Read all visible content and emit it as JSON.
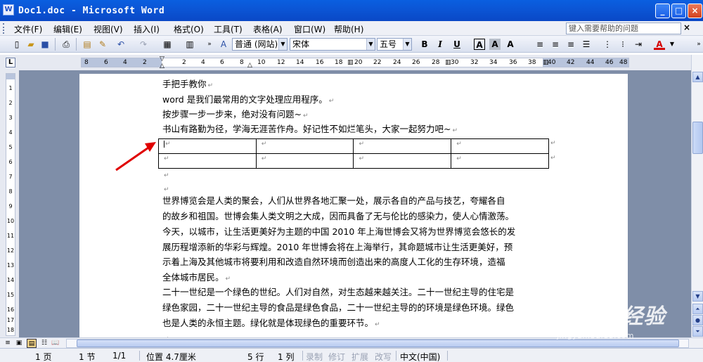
{
  "window": {
    "title": "Doc1.doc - Microsoft Word",
    "app_icon": "W"
  },
  "menu": {
    "items": [
      "文件(F)",
      "编辑(E)",
      "视图(V)",
      "插入(I)",
      "格式(O)",
      "工具(T)",
      "表格(A)",
      "窗口(W)",
      "帮助(H)"
    ],
    "help_placeholder": "键入需要帮助的问题",
    "close_glyph": "×"
  },
  "toolbar": {
    "style_value": "普通 (网站)",
    "font_value": "宋体",
    "size_value": "五号",
    "bold": "B",
    "italic": "I",
    "underline": "U",
    "char_border": "A",
    "char_shade": "A",
    "font_color_glyph": "A",
    "font_color": "#d40000"
  },
  "ruler": {
    "corner": "L",
    "numbers": [
      "8",
      "6",
      "4",
      "2",
      "2",
      "4",
      "6",
      "8",
      "10",
      "12",
      "14",
      "16",
      "18",
      "20",
      "22",
      "24",
      "26",
      "28",
      "30",
      "32",
      "34",
      "36",
      "38",
      "40",
      "42",
      "44",
      "46",
      "48"
    ],
    "vertical_numbers": [
      "1",
      "2",
      "3",
      "4",
      "5",
      "6",
      "7",
      "8",
      "9",
      "10",
      "11",
      "12",
      "13",
      "14",
      "15",
      "16",
      "17",
      "18"
    ]
  },
  "document": {
    "lines": [
      "手把手教你",
      "word 是我们最常用的文字处理应用程序。",
      "按步骤一步一步来，绝对没有问题~",
      "书山有路勤为径，学海无涯苦作舟。好记性不如烂笔头，大家一起努力吧~"
    ],
    "paragraph_mark": "↵",
    "table_rows": 2,
    "table_cols": 4,
    "para1": [
      "世界博览会是人类的聚会，人们从世界各地汇聚一处，展示各自的产品与技艺，夸耀各自",
      "的故乡和祖国。世博会集人类文明之大成，因而具备了无与伦比的感染力，使人心情激荡。",
      "今天，以城市，让生活更美好为主题的中国 2010 年上海世博会又将为世界博览会悠长的发",
      "展历程增添新的华彩与辉煌。2010 年世博会将在上海举行，其命题城市让生活更美好，预",
      "示着上海及其他城市将要利用和改造自然环境而创造出来的高度人工化的生存环境，造福",
      "全体城市居民。"
    ],
    "para2": [
      "二十一世纪是一个绿色的世纪。人们对自然，对生态越来越关注。二十一世纪主导的住宅是",
      "绿色家园，二十一世纪主导的食品是绿色食品，二十一世纪主导的的环境是绿色环境。绿色",
      "也是人类的永恒主题。绿化就是体现绿色的重要环节。"
    ]
  },
  "status": {
    "page": "1 页",
    "section": "1 节",
    "page_of": "1/1",
    "position": "位置 4.7厘米",
    "line": "5 行",
    "column": "1 列",
    "rec": "录制",
    "trk": "修订",
    "ext": "扩展",
    "ovr": "改写",
    "lang": "中文(中国)"
  },
  "watermark": {
    "brand": "Baidu 经验",
    "url": "jingyan.baidu.com"
  },
  "annotation": {
    "arrow_color": "#e00000"
  }
}
